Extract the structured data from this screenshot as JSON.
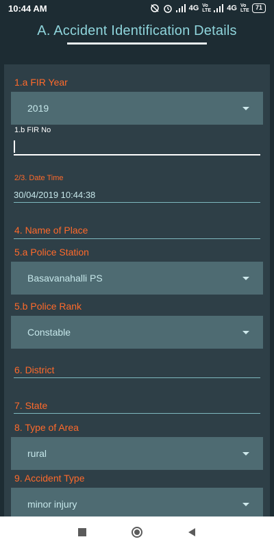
{
  "status": {
    "time": "10:44 AM",
    "network1": "4G",
    "network2": "4G",
    "volte1": "Vo LTE",
    "volte2": "Vo LTE",
    "battery": "71"
  },
  "header": {
    "title": "A. Accident Identification Details"
  },
  "form": {
    "fir_year": {
      "label": "1.a FIR Year",
      "value": "2019"
    },
    "fir_no": {
      "label": "1.b FIR No",
      "value": ""
    },
    "date_time": {
      "label": "2/3. Date Time",
      "value": "30/04/2019 10:44:38"
    },
    "place": {
      "label": "4. Name of Place"
    },
    "police_station": {
      "label": "5.a Police Station",
      "value": "Basavanahalli PS"
    },
    "police_rank": {
      "label": "5.b Police Rank",
      "value": "Constable"
    },
    "district": {
      "label": "6. District"
    },
    "state": {
      "label": "7. State"
    },
    "area_type": {
      "label": "8. Type of Area",
      "value": "rural"
    },
    "accident_type": {
      "label": "9. Accident Type",
      "value": "minor injury"
    }
  },
  "colors": {
    "background": "#1d2c33",
    "card": "#2e3f47",
    "label_orange": "#ff6a2b",
    "title_teal": "#8fd5dc",
    "select_bg": "#4e6b72"
  },
  "icons": {
    "nav_recent": "square-icon",
    "nav_home": "circle-icon",
    "nav_back": "triangle-back-icon"
  }
}
